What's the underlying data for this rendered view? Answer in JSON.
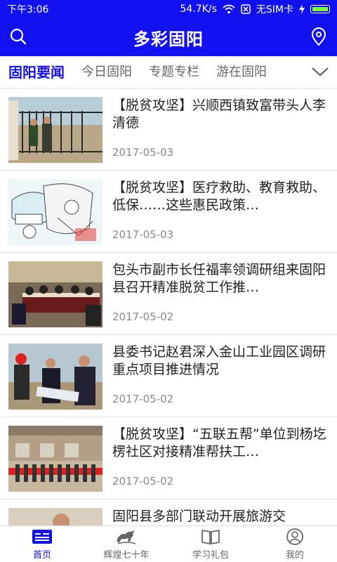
{
  "status": {
    "time": "下午3:06",
    "speed": "54.7K/s",
    "sim": "无SIM卡"
  },
  "appbar": {
    "title": "多彩固阳"
  },
  "tabs": [
    "固阳要闻",
    "今日固阳",
    "专题专栏",
    "游在固阳"
  ],
  "articles": [
    {
      "title": "【脱贫攻坚】兴顺西镇致富带头人李清德",
      "date": "2017-05-03"
    },
    {
      "title": "【脱贫攻坚】医疗救助、教育救助、低保……这些惠民政策…",
      "date": "2017-05-03"
    },
    {
      "title": "包头市副市长任福率领调研组来固阳县召开精准脱贫工作推…",
      "date": "2017-05-02"
    },
    {
      "title": "县委书记赵君深入金山工业园区调研重点项目推进情况",
      "date": "2017-05-02"
    },
    {
      "title": "【脱贫攻坚】“五联五帮”单位到杨圪楞社区对接精准帮扶工…",
      "date": "2017-05-02"
    },
    {
      "title": "固阳县多部门联动开展旅游交",
      "date": ""
    }
  ],
  "nav": [
    {
      "label": "首页",
      "icon": "home-news-icon"
    },
    {
      "label": "辉煌七十年",
      "icon": "horse-icon"
    },
    {
      "label": "学习礼包",
      "icon": "book-icon"
    },
    {
      "label": "我的",
      "icon": "profile-icon"
    }
  ],
  "colors": {
    "primary": "#1010f0",
    "battery": "#7dff3f"
  }
}
